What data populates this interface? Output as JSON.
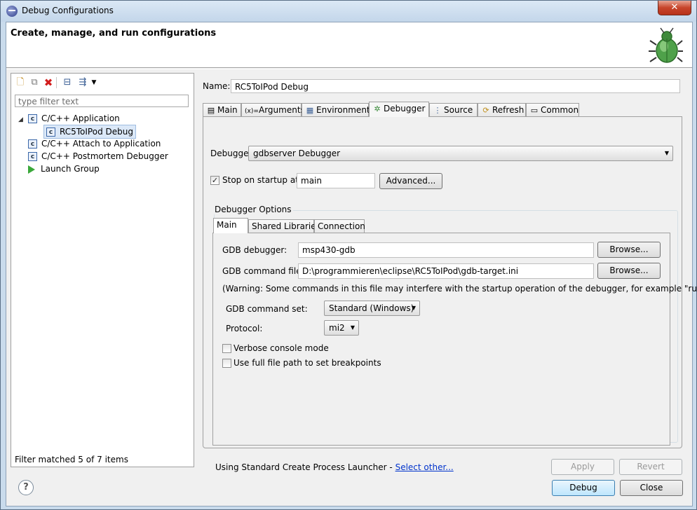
{
  "window": {
    "title": "Debug Configurations",
    "close_glyph": "✕"
  },
  "header": {
    "title": "Create, manage, and run configurations"
  },
  "left": {
    "filter_placeholder": "type filter text",
    "tree": [
      {
        "label": "C/C++ Application",
        "icon": "c-app-icon",
        "expanded": true
      },
      {
        "label": "RC5ToIPod Debug",
        "icon": "c-config-icon",
        "selected": true
      },
      {
        "label": "C/C++ Attach to Application",
        "icon": "c-attach-icon"
      },
      {
        "label": "C/C++ Postmortem Debugger",
        "icon": "c-postmortem-icon"
      },
      {
        "label": "Launch Group",
        "icon": "launch-group-icon"
      }
    ],
    "filter_status": "Filter matched 5 of 7 items"
  },
  "config": {
    "name_label": "Name:",
    "name_value": "RC5ToIPod Debug",
    "tabs": [
      {
        "label": "Main",
        "icon": "▤"
      },
      {
        "label": "Arguments",
        "icon": "(x)="
      },
      {
        "label": "Environment",
        "icon": "▦"
      },
      {
        "label": "Debugger",
        "icon": "✲"
      },
      {
        "label": "Source",
        "icon": "⋮"
      },
      {
        "label": "Refresh",
        "icon": "⟳"
      },
      {
        "label": "Common",
        "icon": "▭"
      }
    ],
    "debugger_label": "Debugger:",
    "debugger_value": "gdbserver Debugger",
    "stop_on_startup_label": "Stop on startup at:",
    "stop_on_startup_checked": true,
    "stop_on_startup_value": "main",
    "advanced_button": "Advanced...",
    "debugger_options_title": "Debugger Options",
    "subtabs": [
      "Main",
      "Shared Libraries",
      "Connection"
    ],
    "gdb_debugger_label": "GDB debugger:",
    "gdb_debugger_value": "msp430-gdb",
    "browse_label": "Browse...",
    "gdb_command_file_label": "GDB command file:",
    "gdb_command_file_value": "D:\\programmieren\\eclipse\\RC5ToIPod\\gdb-target.ini",
    "warning": "(Warning: Some commands in this file may interfere with the startup operation of the debugger, for example \"run\".)",
    "command_set_label": "GDB command set:",
    "command_set_value": "Standard (Windows)",
    "protocol_label": "Protocol:",
    "protocol_value": "mi2",
    "verbose_label": "Verbose console mode",
    "full_path_label": "Use full file path to set breakpoints",
    "launcher_text": "Using Standard Create Process Launcher - ",
    "launcher_link": "Select other...",
    "apply_button": "Apply",
    "revert_button": "Revert"
  },
  "footer": {
    "help_glyph": "?",
    "debug_button": "Debug",
    "close_button": "Close"
  },
  "colors": {
    "link": "#0033cc",
    "selection": "#dbe8f8"
  }
}
